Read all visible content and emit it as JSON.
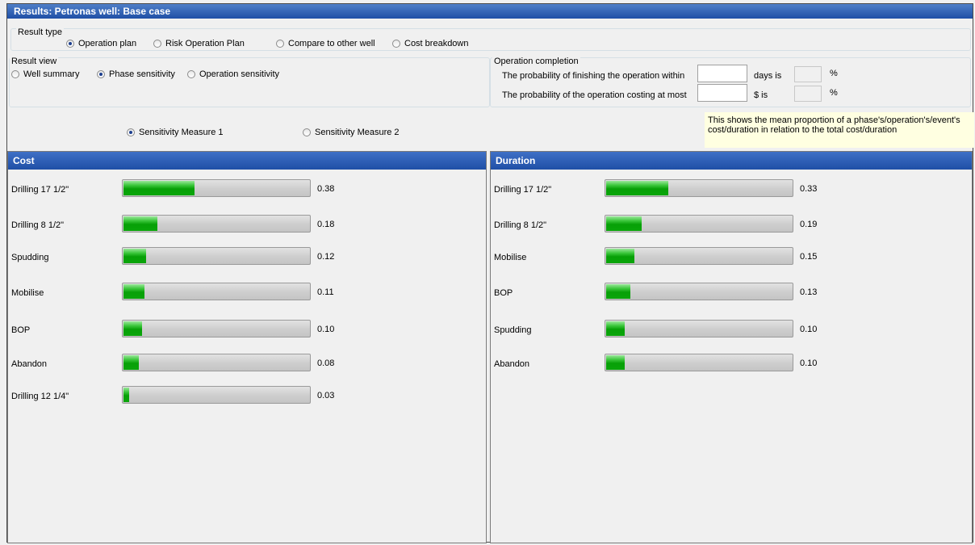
{
  "window": {
    "title": "Results: Petronas well: Base case"
  },
  "result_type": {
    "label": "Result type",
    "options": [
      "Operation plan",
      "Risk Operation Plan",
      "Compare to other well",
      "Cost breakdown"
    ],
    "selected": 0
  },
  "result_view": {
    "label": "Result view",
    "options": [
      "Well summary",
      "Phase sensitivity",
      "Operation sensitivity"
    ],
    "selected": 1
  },
  "operation_completion": {
    "label": "Operation completion",
    "row1_text": "The probability of finishing the operation within",
    "row1_unit": "days is",
    "row1_pct": "%",
    "row2_text": "The probability of the operation costing at most",
    "row2_unit": "$ is",
    "row2_pct": "%"
  },
  "sensitivity": {
    "options": [
      "Sensitivity Measure 1",
      "Sensitivity Measure 2"
    ],
    "selected": 0
  },
  "tooltip": "This shows the mean proportion of a phase's/operation's/event's cost/duration in relation to the total cost/duration",
  "cost": {
    "title": "Cost",
    "rows": [
      {
        "name": "Drilling 17 1/2\"",
        "value": "0.38",
        "fraction": 0.38
      },
      {
        "name": "Drilling 8 1/2\"",
        "value": "0.18",
        "fraction": 0.18
      },
      {
        "name": "Spudding",
        "value": "0.12",
        "fraction": 0.12
      },
      {
        "name": "Mobilise",
        "value": "0.11",
        "fraction": 0.11
      },
      {
        "name": "BOP",
        "value": "0.10",
        "fraction": 0.1
      },
      {
        "name": "Abandon",
        "value": "0.08",
        "fraction": 0.08
      },
      {
        "name": "Drilling 12 1/4\"",
        "value": "0.03",
        "fraction": 0.03
      }
    ]
  },
  "duration": {
    "title": "Duration",
    "rows": [
      {
        "name": "Drilling 17 1/2\"",
        "value": "0.33",
        "fraction": 0.33
      },
      {
        "name": "Drilling 8 1/2\"",
        "value": "0.19",
        "fraction": 0.19
      },
      {
        "name": "Mobilise",
        "value": "0.15",
        "fraction": 0.15
      },
      {
        "name": "BOP",
        "value": "0.13",
        "fraction": 0.13
      },
      {
        "name": "Spudding",
        "value": "0.10",
        "fraction": 0.1
      },
      {
        "name": "Abandon",
        "value": "0.10",
        "fraction": 0.1
      }
    ]
  }
}
